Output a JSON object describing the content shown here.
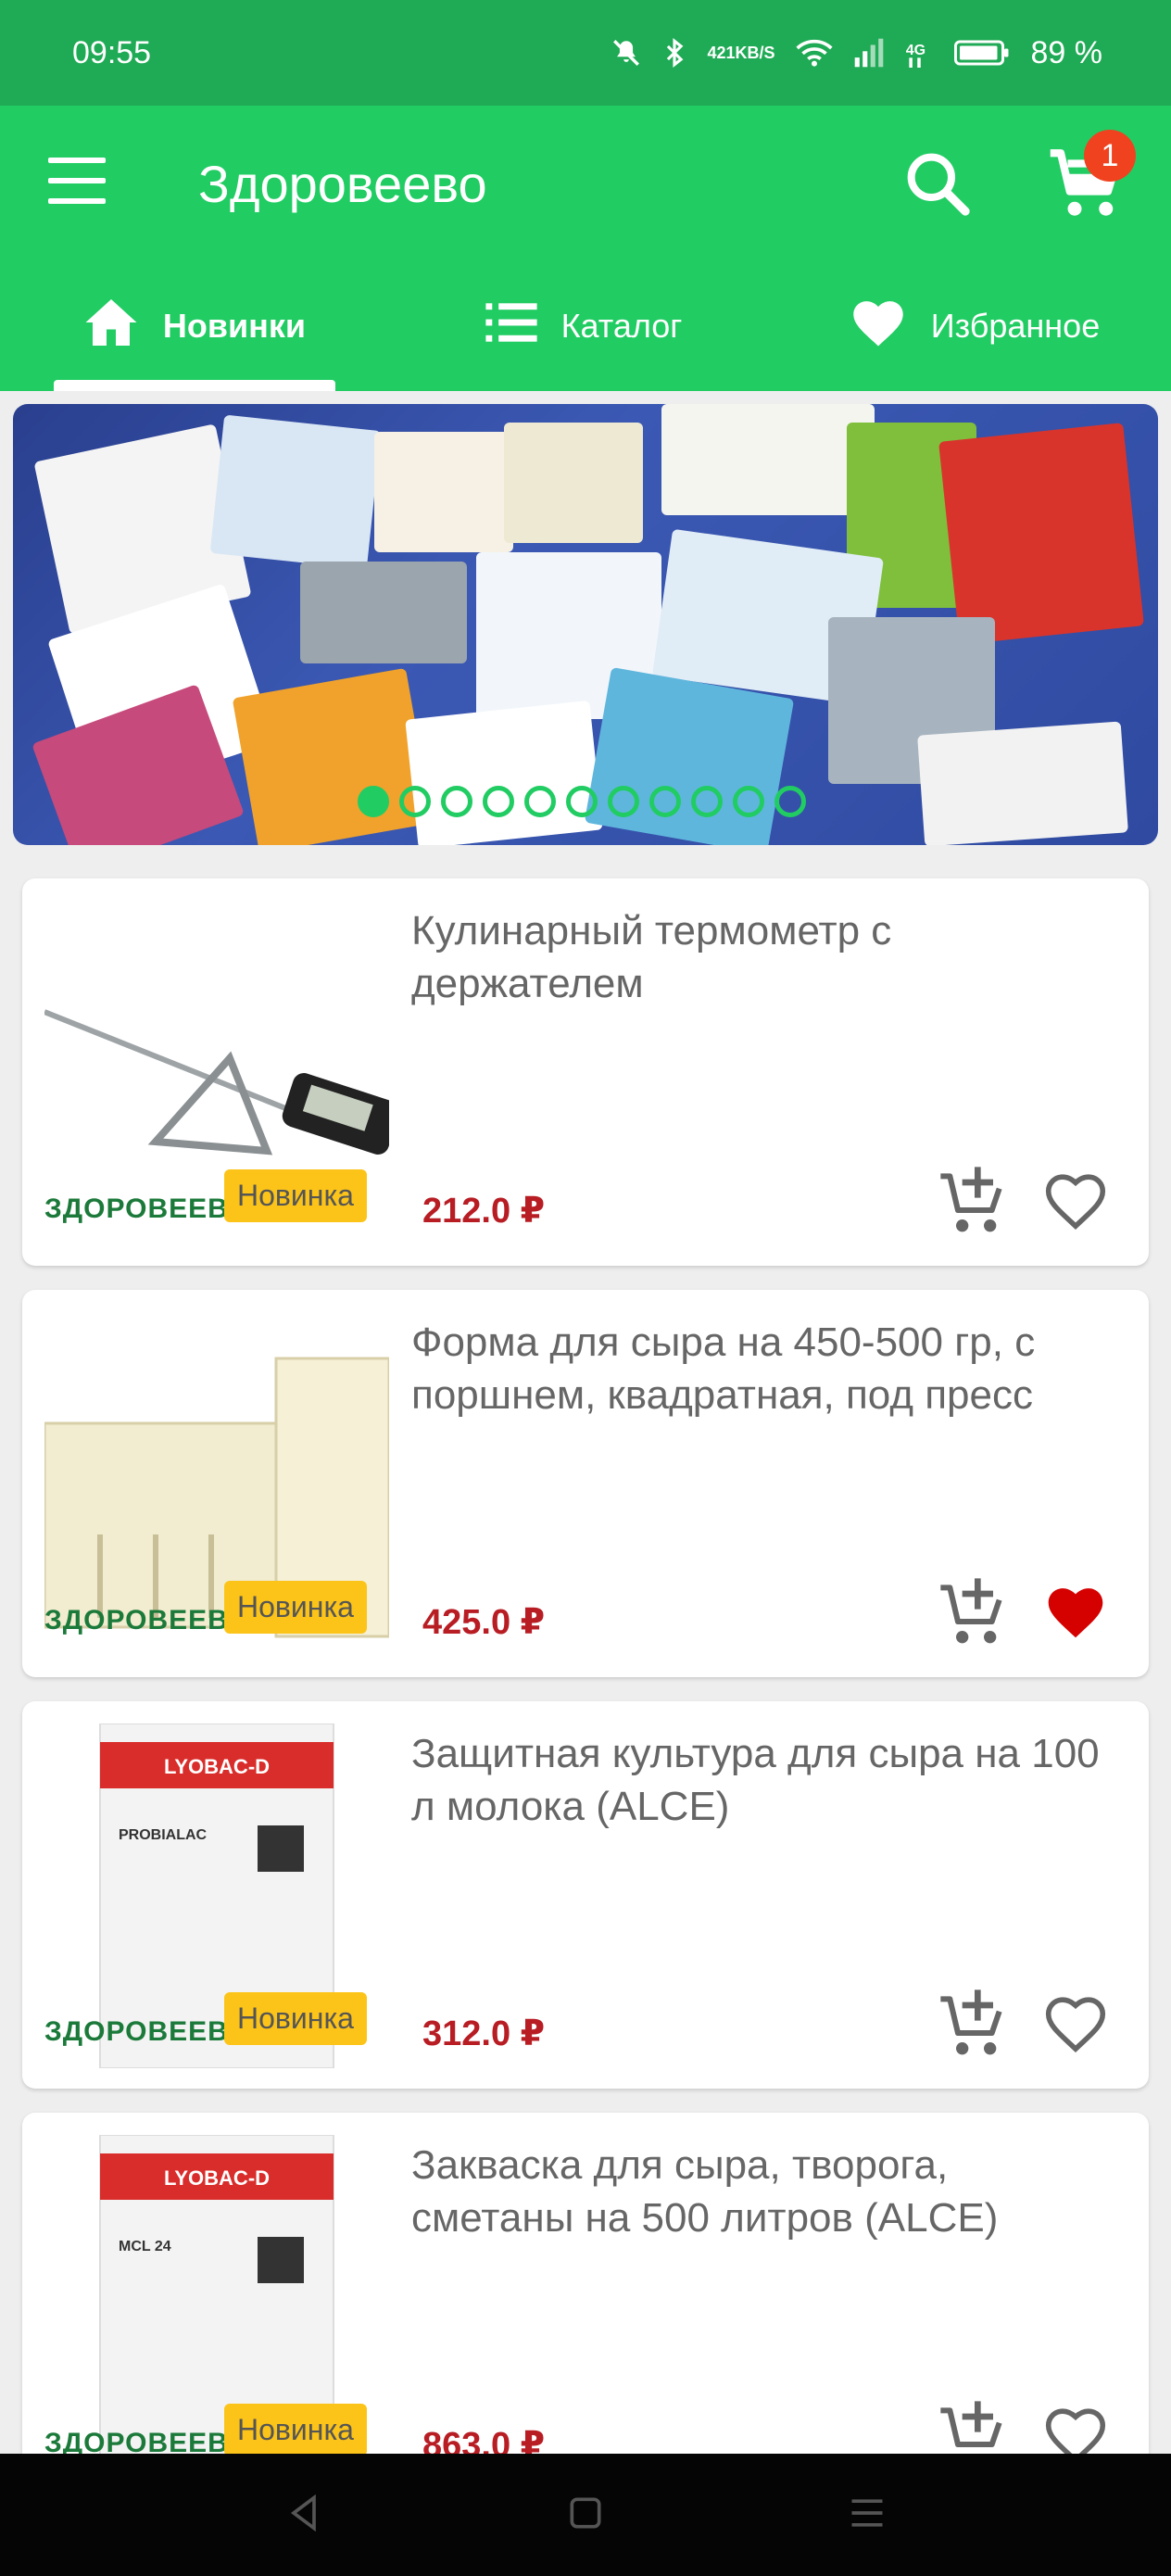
{
  "status_bar": {
    "time": "09:55",
    "net_speed_value": "421",
    "net_speed_unit": "KB/S",
    "battery": "89 %",
    "icons": [
      "mute-icon",
      "bluetooth-icon",
      "wifi-icon",
      "signal-icon",
      "4g-icon",
      "battery-icon"
    ]
  },
  "app_bar": {
    "title": "Здоровеево",
    "cart_count": "1",
    "icons": [
      "menu-icon",
      "search-icon",
      "cart-icon"
    ]
  },
  "tabs": [
    {
      "label": "Новинки",
      "icon": "home-icon",
      "active": true
    },
    {
      "label": "Каталог",
      "icon": "list-icon",
      "active": false
    },
    {
      "label": "Избранное",
      "icon": "heart-icon",
      "active": false
    }
  ],
  "banner": {
    "slides": 11,
    "active_slide": 1
  },
  "products": [
    {
      "title": "Кулинарный термометр с держателем",
      "price": "212.0 ₽",
      "badge": "Новинка",
      "brand": "ЗДОРОВЕЕВО",
      "favorite": false
    },
    {
      "title": "Форма для сыра на 450-500 гр, с поршнем, квадратная, под пресс",
      "price": "425.0 ₽",
      "badge": "Новинка",
      "brand": "ЗДОРОВЕЕВО",
      "favorite": true
    },
    {
      "title": "Защитная культура для сыра на 100 л молока (ALCE)",
      "price": "312.0 ₽",
      "badge": "Новинка",
      "brand": "ЗДОРОВЕЕВО",
      "favorite": false
    },
    {
      "title": "Закваска для сыра, творога, сметаны на 500 литров (ALCE)",
      "price": "863.0 ₽",
      "badge": "Новинка",
      "brand": "ЗДОРОВЕЕВО",
      "favorite": false
    }
  ],
  "product_images": [
    {
      "label_1": "",
      "label_2": ""
    },
    {
      "label_1": "",
      "label_2": ""
    },
    {
      "label_1": "LYOBAC-D",
      "label_2": "PROBIALAC"
    },
    {
      "label_1": "LYOBAC-D",
      "label_2": "MCL 24"
    }
  ],
  "colors": {
    "status_bar": "#1faa55",
    "app_bar": "#21cc63",
    "price": "#b81d24",
    "badge": "#fcc419",
    "favorite_active": "#d50000"
  },
  "nav_bar": {
    "icons": [
      "back-icon",
      "home-icon",
      "recents-icon"
    ]
  }
}
